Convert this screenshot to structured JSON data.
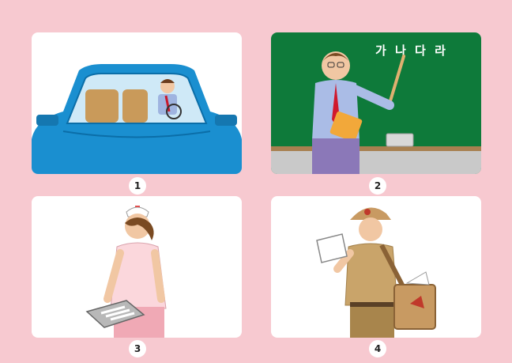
{
  "panels": [
    {
      "number": "1",
      "icon": "driver-in-car-illustration"
    },
    {
      "number": "2",
      "icon": "teacher-at-chalkboard-illustration",
      "board_text": "가 나 다 라"
    },
    {
      "number": "3",
      "icon": "nurse-with-tray-illustration"
    },
    {
      "number": "4",
      "icon": "mail-carrier-with-letter-illustration"
    }
  ],
  "colors": {
    "background": "#f7c9d0",
    "card": "#ffffff",
    "car": "#1a8fd0",
    "chalkboard": "#0e7a3a"
  }
}
